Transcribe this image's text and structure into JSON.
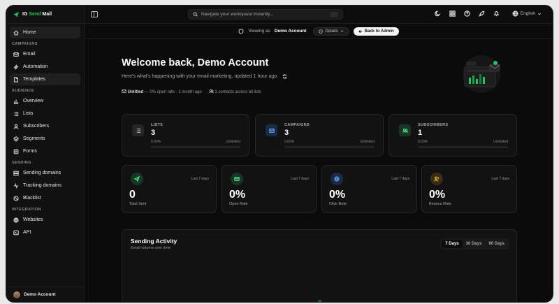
{
  "brand": {
    "prefix": "IG",
    "accent": "Send",
    "suffix": "Mail"
  },
  "nav": {
    "home": "Home",
    "sections": {
      "campaigns": "CAMPAIGNS",
      "audience": "AUDIENCE",
      "sending": "SENDING",
      "integration": "INTEGRATION"
    },
    "items": {
      "email": "Email",
      "automation": "Automation",
      "templates": "Templates",
      "overview": "Overview",
      "lists": "Lists",
      "subscribers": "Subscribers",
      "segments": "Segments",
      "forms": "Forms",
      "sending_domains": "Sending domains",
      "tracking_domains": "Tracking domains",
      "blacklist": "Blacklist",
      "websites": "Websites",
      "api": "API"
    }
  },
  "user": {
    "name": "Demo Account"
  },
  "topbar": {
    "search_placeholder": "Navigate your workspace instantly...",
    "language": "English"
  },
  "viewing": {
    "prefix": "Viewing as",
    "account": "Demo Account",
    "details_label": "Details",
    "back_label": "Back to Admin"
  },
  "welcome": {
    "title": "Welcome back, Demo Account",
    "subtitle": "Here's what's happening with your email marketing, updated 1 hour ago.",
    "meta_campaign": "Untitled",
    "meta_campaign_rest": "— 0% open rate · 1 month ago",
    "meta_contacts": "1 contacts across all lists"
  },
  "stats": [
    {
      "label": "LISTS",
      "value": "3",
      "pct": "0.00%",
      "limit": "Unlimited",
      "color": "#9ca3af"
    },
    {
      "label": "CAMPAIGNS",
      "value": "3",
      "pct": "0.00%",
      "limit": "Unlimited",
      "color": "#60a5fa"
    },
    {
      "label": "SUBSCRIBERS",
      "value": "1",
      "pct": "0.00%",
      "limit": "Unlimited",
      "color": "#4ade80"
    }
  ],
  "metrics": [
    {
      "period": "Last 7 days",
      "value": "0",
      "label": "Total Sent",
      "color": "#4ade80"
    },
    {
      "period": "Last 7 days",
      "value": "0%",
      "label": "Open Rate",
      "color": "#4ade80"
    },
    {
      "period": "Last 7 days",
      "value": "0%",
      "label": "Click Rate",
      "color": "#60a5fa"
    },
    {
      "period": "Last 7 days",
      "value": "0%",
      "label": "Bounce Rate",
      "color": "#fbbf24"
    }
  ],
  "activity": {
    "title": "Sending Activity",
    "subtitle": "Email volume over time",
    "tabs": [
      "7 Days",
      "30 Days",
      "90 Days"
    ],
    "active_tab": "7 Days"
  },
  "colors": {
    "accent": "#22c55e",
    "background": "#0b0b0b",
    "card": "#121212"
  }
}
